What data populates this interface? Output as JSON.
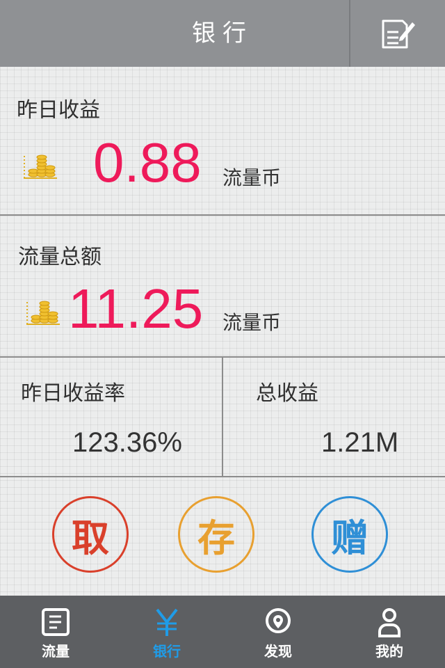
{
  "header": {
    "title": "银行",
    "compose_icon": "compose-icon"
  },
  "yesterday_income": {
    "label": "昨日收益",
    "value": "0.88",
    "unit": "流量币",
    "icon": "coin-stack-icon"
  },
  "total_flow": {
    "label": "流量总额",
    "value": "11.25",
    "unit": "流量币",
    "icon": "coin-stack-icon"
  },
  "stats": {
    "rate_label": "昨日收益率",
    "rate_value": "123.36%",
    "total_label": "总收益",
    "total_value": "1.21M"
  },
  "actions": [
    {
      "label": "取",
      "color": "#d9402b"
    },
    {
      "label": "存",
      "color": "#e8a030"
    },
    {
      "label": "赠",
      "color": "#2f8fd6"
    }
  ],
  "tabs": [
    {
      "label": "流量",
      "icon": "document-icon",
      "active": false
    },
    {
      "label": "银行",
      "icon": "yen-icon",
      "active": true
    },
    {
      "label": "发现",
      "icon": "location-pin-icon",
      "active": false
    },
    {
      "label": "我的",
      "icon": "person-icon",
      "active": false
    }
  ],
  "colors": {
    "header_bg": "#8f9194",
    "accent_number": "#ee1a5a",
    "tabbar_bg": "#5d5f62",
    "tab_active": "#1f9ce8"
  }
}
